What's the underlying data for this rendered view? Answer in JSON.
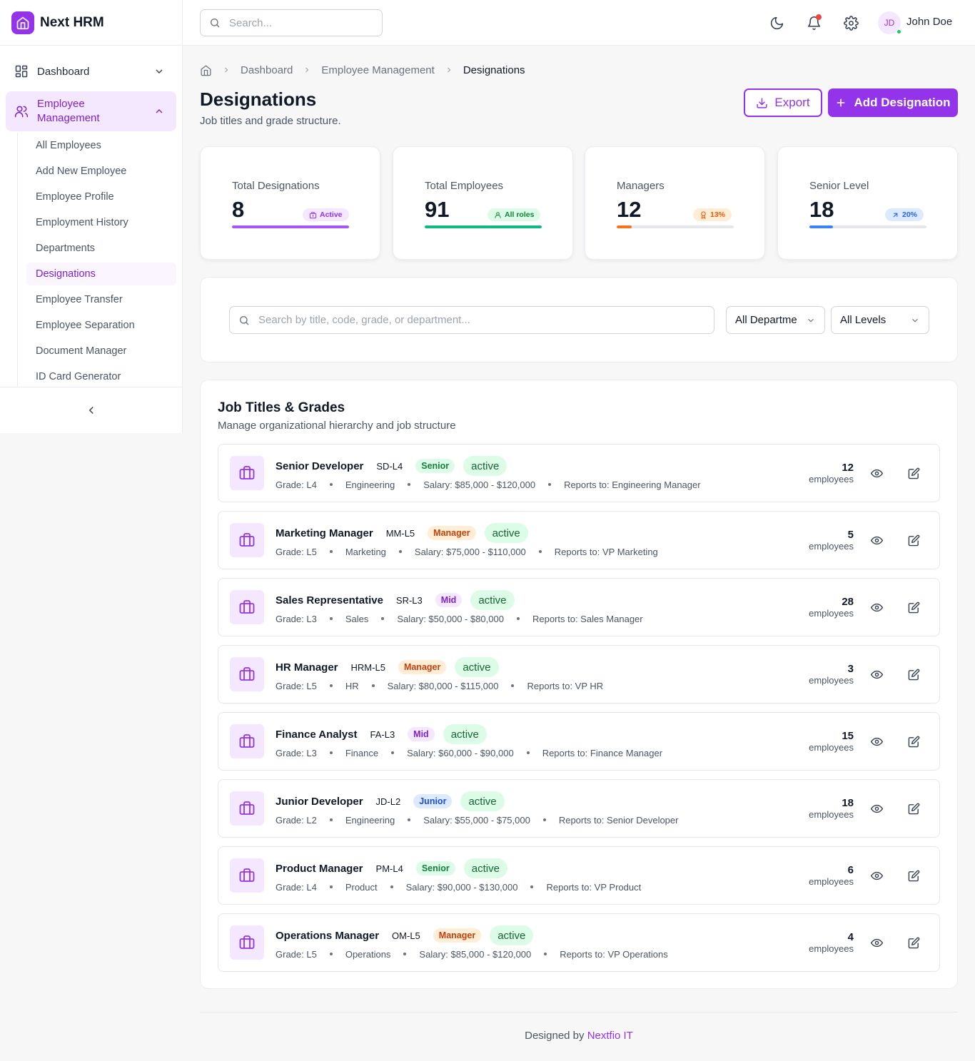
{
  "app": {
    "name": "Next HRM"
  },
  "sidebar": {
    "dashboard_label": "Dashboard",
    "employee_management_label_1": "Employee",
    "employee_management_label_2": "Management",
    "sub_items": [
      {
        "label": "All Employees",
        "active": false
      },
      {
        "label": "Add New Employee",
        "active": false
      },
      {
        "label": "Employee Profile",
        "active": false
      },
      {
        "label": "Employment History",
        "active": false
      },
      {
        "label": "Departments",
        "active": false
      },
      {
        "label": "Designations",
        "active": true
      },
      {
        "label": "Employee Transfer",
        "active": false
      },
      {
        "label": "Employee Separation",
        "active": false
      },
      {
        "label": "Document Manager",
        "active": false
      },
      {
        "label": "ID Card Generator",
        "active": false
      }
    ]
  },
  "topbar": {
    "search_placeholder": "Search...",
    "user_initials": "JD",
    "user_name": "John Doe",
    "icons": [
      "moon-icon",
      "bell-icon",
      "gear-icon"
    ]
  },
  "breadcrumb": {
    "items": [
      "Dashboard",
      "Employee Management"
    ],
    "current": "Designations"
  },
  "page": {
    "title": "Designations",
    "subtitle": "Job titles and grade structure.",
    "export_label": "Export",
    "add_label": "Add Designation"
  },
  "stats": [
    {
      "label": "Total Designations",
      "value": "8",
      "badge": "Active",
      "badge_icon": "building-icon",
      "progress": 1.0,
      "color": "#a855f7",
      "badge_bg": "#f3e8ff",
      "badge_fg": "#9333ea"
    },
    {
      "label": "Total Employees",
      "value": "91",
      "badge": "All roles",
      "badge_icon": "user-icon",
      "progress": 1.0,
      "color": "#10b981",
      "badge_bg": "#dcfce7",
      "badge_fg": "#15803d"
    },
    {
      "label": "Managers",
      "value": "12",
      "badge": "13%",
      "badge_icon": "award-icon",
      "progress": 0.13,
      "color": "#f97316",
      "badge_bg": "#ffedd5",
      "badge_fg": "#ea580c"
    },
    {
      "label": "Senior Level",
      "value": "18",
      "badge": "20%",
      "badge_icon": "arrow-up-right-icon",
      "progress": 0.2,
      "color": "#3b82f6",
      "badge_bg": "#dbeafe",
      "badge_fg": "#2563eb"
    }
  ],
  "filters": {
    "search_placeholder": "Search by title, code, grade, or department...",
    "department": "All Departme",
    "level": "All Levels"
  },
  "list": {
    "title": "Job Titles & Grades",
    "subtitle": "Manage organizational hierarchy and job structure",
    "count_label": "employees",
    "jobs": [
      {
        "title": "Senior Developer",
        "code": "SD-L4",
        "level": "Senior",
        "status": "active",
        "grade": "Grade: L4",
        "department": "Engineering",
        "salary": "Salary: $85,000 - $120,000",
        "reports_to": "Reports to: Engineering Manager",
        "count": "12"
      },
      {
        "title": "Marketing Manager",
        "code": "MM-L5",
        "level": "Manager",
        "status": "active",
        "grade": "Grade: L5",
        "department": "Marketing",
        "salary": "Salary: $75,000 - $110,000",
        "reports_to": "Reports to: VP Marketing",
        "count": "5"
      },
      {
        "title": "Sales Representative",
        "code": "SR-L3",
        "level": "Mid",
        "status": "active",
        "grade": "Grade: L3",
        "department": "Sales",
        "salary": "Salary: $50,000 - $80,000",
        "reports_to": "Reports to: Sales Manager",
        "count": "28"
      },
      {
        "title": "HR Manager",
        "code": "HRM-L5",
        "level": "Manager",
        "status": "active",
        "grade": "Grade: L5",
        "department": "HR",
        "salary": "Salary: $80,000 - $115,000",
        "reports_to": "Reports to: VP HR",
        "count": "3"
      },
      {
        "title": "Finance Analyst",
        "code": "FA-L3",
        "level": "Mid",
        "status": "active",
        "grade": "Grade: L3",
        "department": "Finance",
        "salary": "Salary: $60,000 - $90,000",
        "reports_to": "Reports to: Finance Manager",
        "count": "15"
      },
      {
        "title": "Junior Developer",
        "code": "JD-L2",
        "level": "Junior",
        "status": "active",
        "grade": "Grade: L2",
        "department": "Engineering",
        "salary": "Salary: $55,000 - $75,000",
        "reports_to": "Reports to: Senior Developer",
        "count": "18"
      },
      {
        "title": "Product Manager",
        "code": "PM-L4",
        "level": "Senior",
        "status": "active",
        "grade": "Grade: L4",
        "department": "Product",
        "salary": "Salary: $90,000 - $130,000",
        "reports_to": "Reports to: VP Product",
        "count": "6"
      },
      {
        "title": "Operations Manager",
        "code": "OM-L5",
        "level": "Manager",
        "status": "active",
        "grade": "Grade: L5",
        "department": "Operations",
        "salary": "Salary: $85,000 - $120,000",
        "reports_to": "Reports to: VP Operations",
        "count": "4"
      }
    ]
  },
  "footer": {
    "prefix": "Designed by",
    "brand": "Nextfio IT"
  }
}
